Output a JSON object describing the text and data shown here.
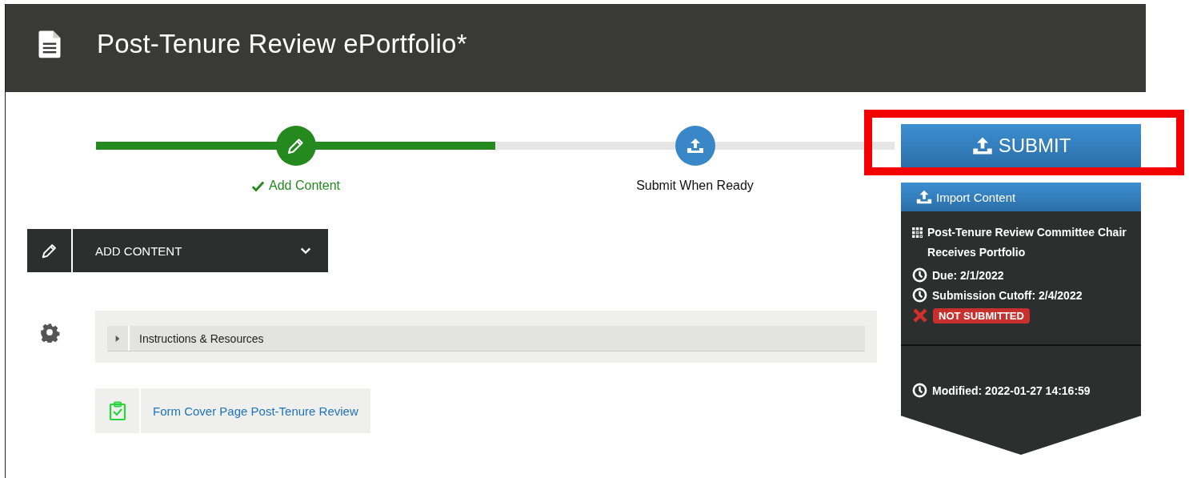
{
  "header": {
    "title": "Post-Tenure Review ePortfolio*"
  },
  "progress": {
    "level": 0.5,
    "steps": [
      {
        "label": "Add Content",
        "completed": true,
        "kind": "edit"
      },
      {
        "label": "Submit When Ready",
        "completed": false,
        "kind": "upload"
      }
    ]
  },
  "submit_button": {
    "label": "SUBMIT",
    "highlighted": true
  },
  "add_content_menu": {
    "label": "ADD CONTENT",
    "expanded": false
  },
  "sections": [
    {
      "title": "Instructions & Resources",
      "expanded": false
    }
  ],
  "forms": [
    {
      "title": "Form Cover Page Post-Tenure Review"
    }
  ],
  "side_panel": {
    "import_button": "Import Content",
    "workflow_step": "Post-Tenure Review Committee Chair Receives Portfolio",
    "due": "Due: 2/1/2022",
    "cutoff": "Submission Cutoff: 2/4/2022",
    "status": "NOT SUBMITTED",
    "submitted": false,
    "modified": "Modified: 2022-01-27 14:16:59"
  }
}
